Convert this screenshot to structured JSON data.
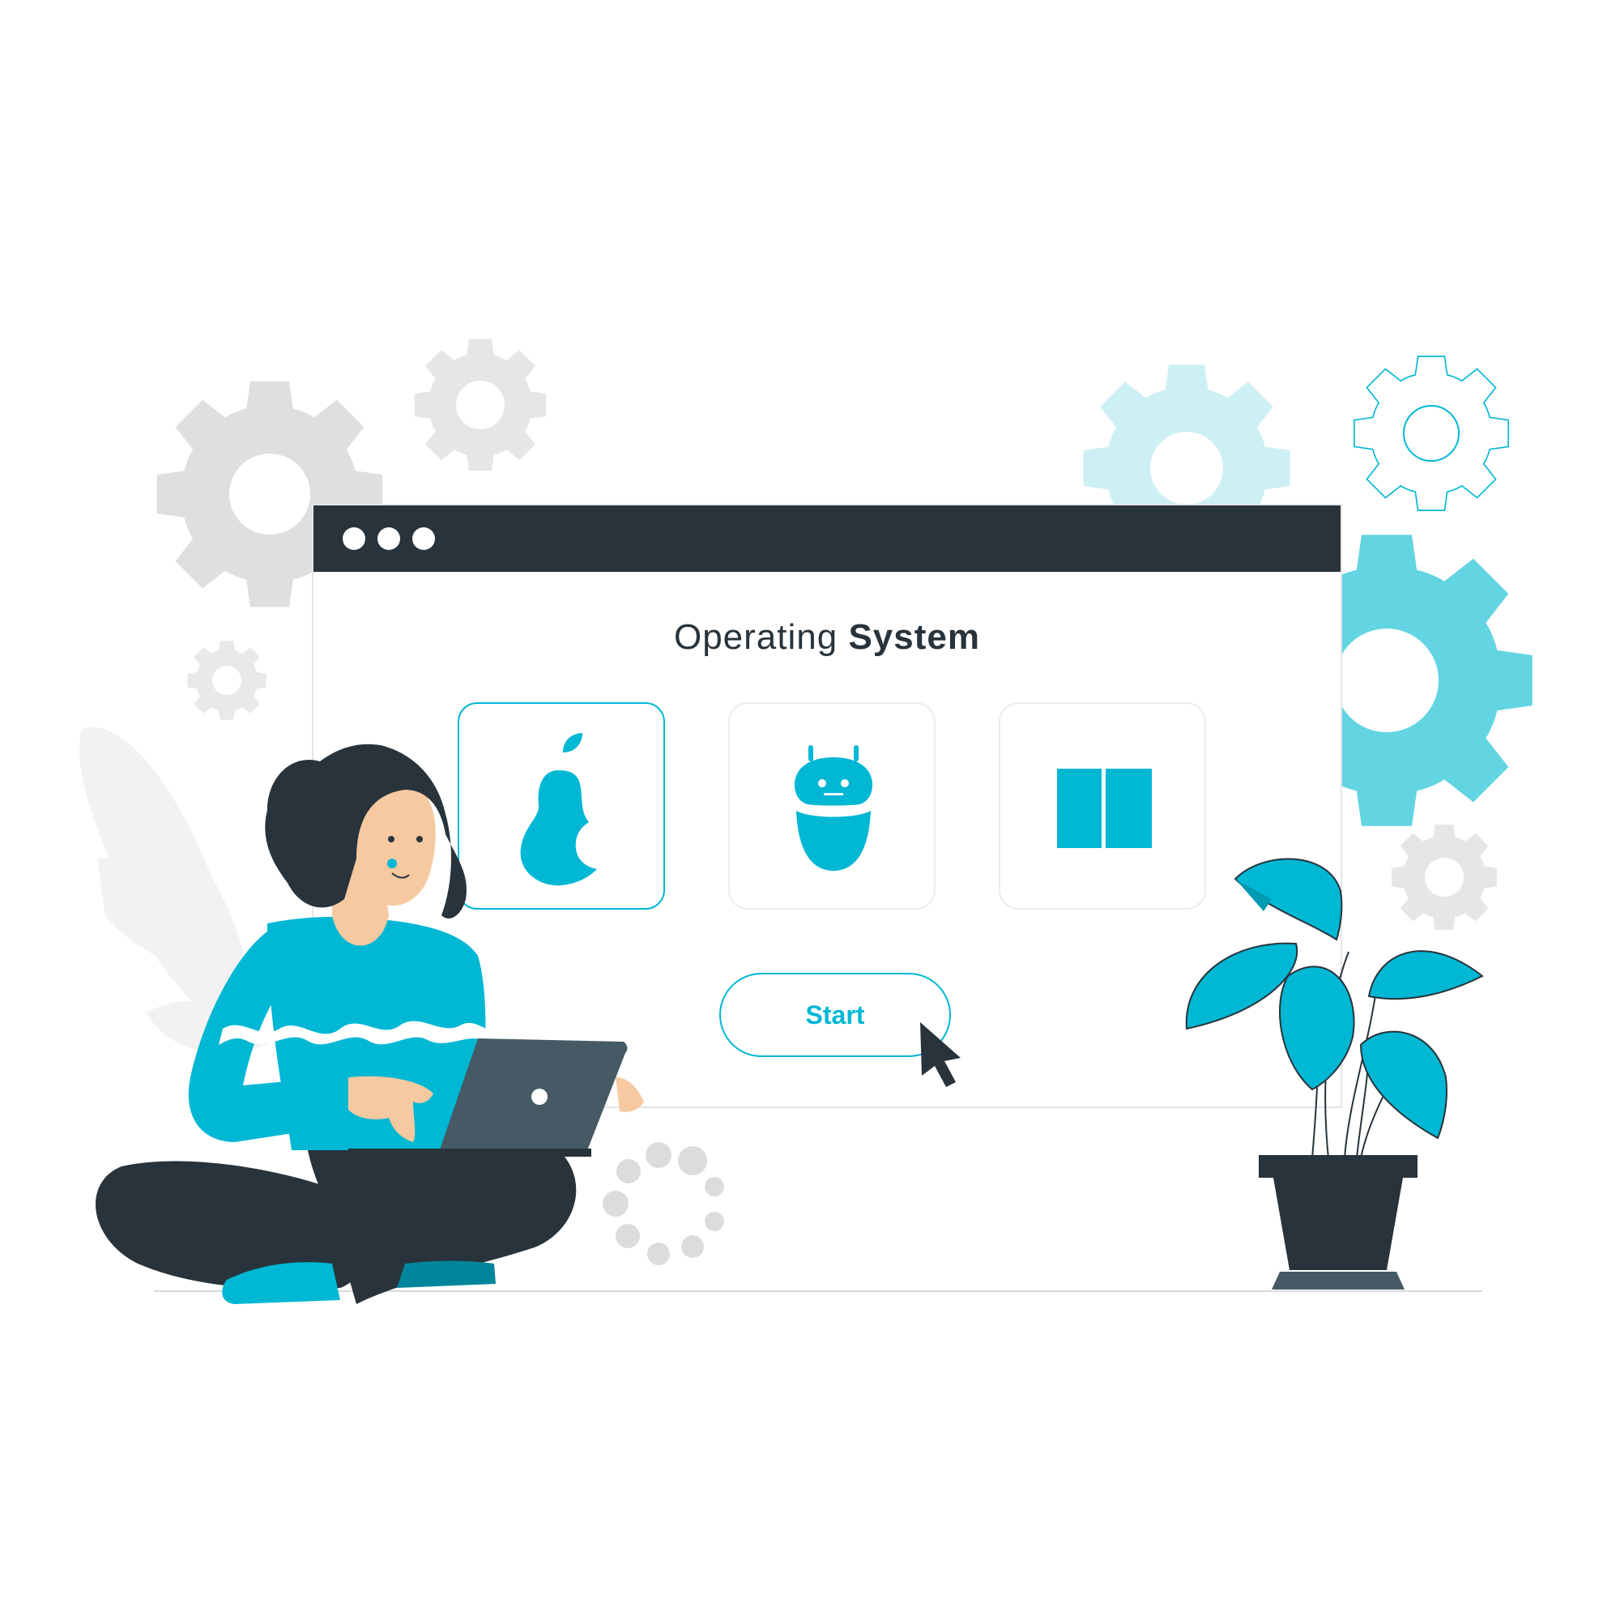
{
  "window": {
    "title_light": "Operating ",
    "title_bold": "System",
    "start_label": "Start"
  },
  "os_options": [
    {
      "icon": "pear-icon",
      "selected": true
    },
    {
      "icon": "robot-icon",
      "selected": false
    },
    {
      "icon": "window-panes-icon",
      "selected": false
    }
  ],
  "colors": {
    "accent": "#00b7d4",
    "dark": "#28333b",
    "gear_gray": "#dfdfdf",
    "gear_light_blue": "#cdf0f4",
    "gear_blue": "#63d4e2"
  }
}
